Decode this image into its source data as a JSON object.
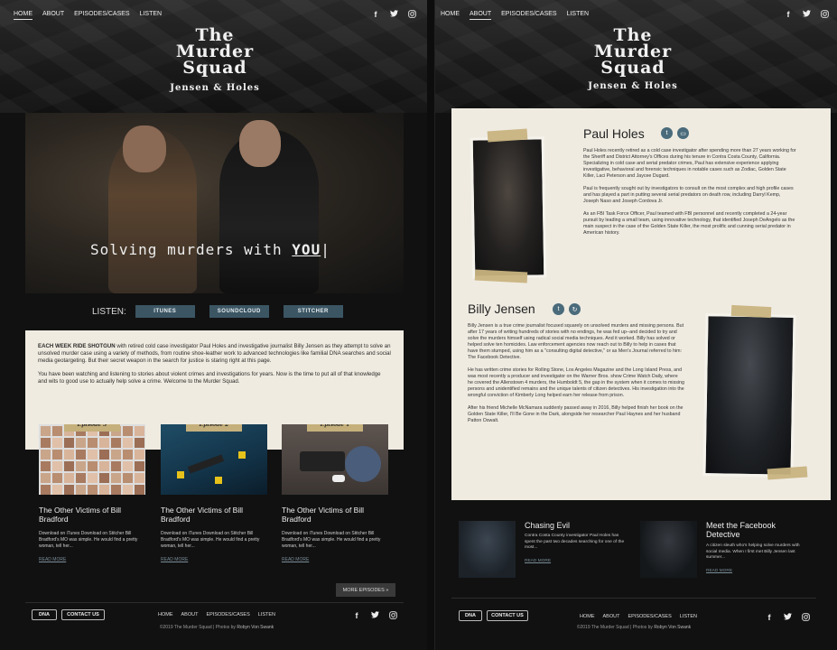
{
  "home": {
    "nav": [
      "HOME",
      "ABOUT",
      "EPISODES/CASES",
      "LISTEN"
    ],
    "nav_active": "HOME",
    "logo": {
      "line1": "The",
      "line2": "Murder",
      "line3": "Squad",
      "subtitle": "Jensen & Holes"
    },
    "headline": {
      "text": "Solving murders with ",
      "emphasis": "YOU",
      "cursor": "|"
    },
    "listen": {
      "label": "LISTEN:",
      "buttons": [
        "ITUNES",
        "SOUNDCLOUD",
        "STITCHER"
      ]
    },
    "intro": {
      "lead": "EACH WEEK RIDE SHOTGUN",
      "p1_rest": " with retired cold case investigator Paul Holes and investigative journalist Billy Jensen as they attempt to solve an unsolved murder case using a variety of methods, from routine shoe-leather work to advanced technologies like familial DNA searches and social media geotargeting. But their secret weapon in the search for justice is staring right at this page.",
      "p2": "You have been watching and listening to stories about violent crimes and investigations for years. Now is the time to put all of that knowledge and wits to good use to actually help solve a crime. Welcome to the Murder Squad."
    },
    "episodes": [
      {
        "tag": "Episode 3",
        "title": "The Other Victims of Bill Bradford",
        "desc": "Download on iTunes Download on Stitcher Bill Bradford's MO was simple. He would find a pretty woman, tell her...",
        "more": "READ MORE"
      },
      {
        "tag": "Episode 2",
        "title": "The Other Victims of Bill Bradford",
        "desc": "Download on iTunes Download on Stitcher Bill Bradford's MO was simple. He would find a pretty woman, tell her...",
        "more": "READ MORE"
      },
      {
        "tag": "Episode 1",
        "title": "The Other Victims of Bill Bradford",
        "desc": "Download on iTunes Download on Stitcher Bill Bradford's MO was simple. He would find a pretty woman, tell her...",
        "more": "READ MORE"
      }
    ],
    "more_episodes": "MORE EPISODES »"
  },
  "about": {
    "nav": [
      "HOME",
      "ABOUT",
      "EPISODES/CASES",
      "LISTEN"
    ],
    "nav_active": "ABOUT",
    "paul": {
      "name": "Paul Holes",
      "p1": "Paul Holes recently retired as a cold case investigator after spending more than 27 years working for the Sheriff and District Attorney's Offices during his tenure in Contra Costa County, California. Specializing in cold case and serial predator crimes, Paul has extensive experience applying investigative, behavioral and forensic techniques in notable cases such as Zodiac, Golden State Killer, Laci Peterson and Jaycee Dugard.",
      "p2": "Paul is frequently sought out by investigators to consult on the most complex and high profile cases and has played a part in putting several serial predators on death row, including Darryl Kemp, Joseph Naso and Joseph Cordova Jr.",
      "p3": "As an FBI Task Force Officer, Paul teamed with FBI personnel and recently completed a 24-year pursuit by leading a small team, using innovative technology, that identified Joseph DeAngelo as the main suspect in the case of the Golden State Killer, the most prolific and cunning serial predator in American history."
    },
    "billy": {
      "name": "Billy Jensen",
      "p1": "Billy Jensen is a true crime journalist focused squarely on unsolved murders and missing persons. But after 17 years of writing hundreds of stories with no endings, he was fed up--and decided to try and solve the murders himself using radical social media techniques. And it worked. Billy has solved or helped solve ten homicides. Law enforcement agencies now reach out to Billy to help in cases that have them stumped, using him as a \"consulting digital detective,\" or as Men's Journal referred to him: The Facebook Detective.",
      "p2": "He has written crime stories for Rolling Stone, Los Angeles Magazine and the Long Island Press, and was most recently a producer and investigator on the Warner Bros. show Crime Watch Daily, where he covered the Allenstown 4 murders, the Humboldt 5, the gap in the system when it comes to missing persons and unidentified remains and the unique talents of citizen detectives. His investigation into the wrongful conviction of Kimberly Long helped earn her release from prison.",
      "p3": "After his friend Michelle McNamara suddenly passed away in 2016, Billy helped finish her book on the Golden State Killer, I'll Be Gone in the Dark, alongside her researcher Paul Haynes and her husband Patton Oswalt."
    },
    "cards": [
      {
        "title": "Chasing Evil",
        "desc": "Contra Costa County investigator Paul Holes has spent the past two decades searching for one of the most...",
        "more": "READ MORE"
      },
      {
        "title": "Meet the Facebook Detective",
        "desc": "A citizen sleuth who's helping solve murders with social media. When I first met Billy Jensen last summer...",
        "more": "READ MORE"
      }
    ]
  },
  "footer": {
    "buttons": [
      "DNA",
      "CONTACT US"
    ],
    "nav": [
      "HOME",
      "ABOUT",
      "EPISODES/CASES",
      "LISTEN"
    ],
    "copyright": "©2019 The Murder Squad  |  Photos by ",
    "photographer": "Robyn Von Swank"
  },
  "social_icons": [
    "facebook-icon",
    "twitter-icon",
    "instagram-icon"
  ],
  "colors": {
    "paper": "#efebe1",
    "button": "#3b5563",
    "link": "#7a8d98",
    "tape": "#c5b07c"
  }
}
